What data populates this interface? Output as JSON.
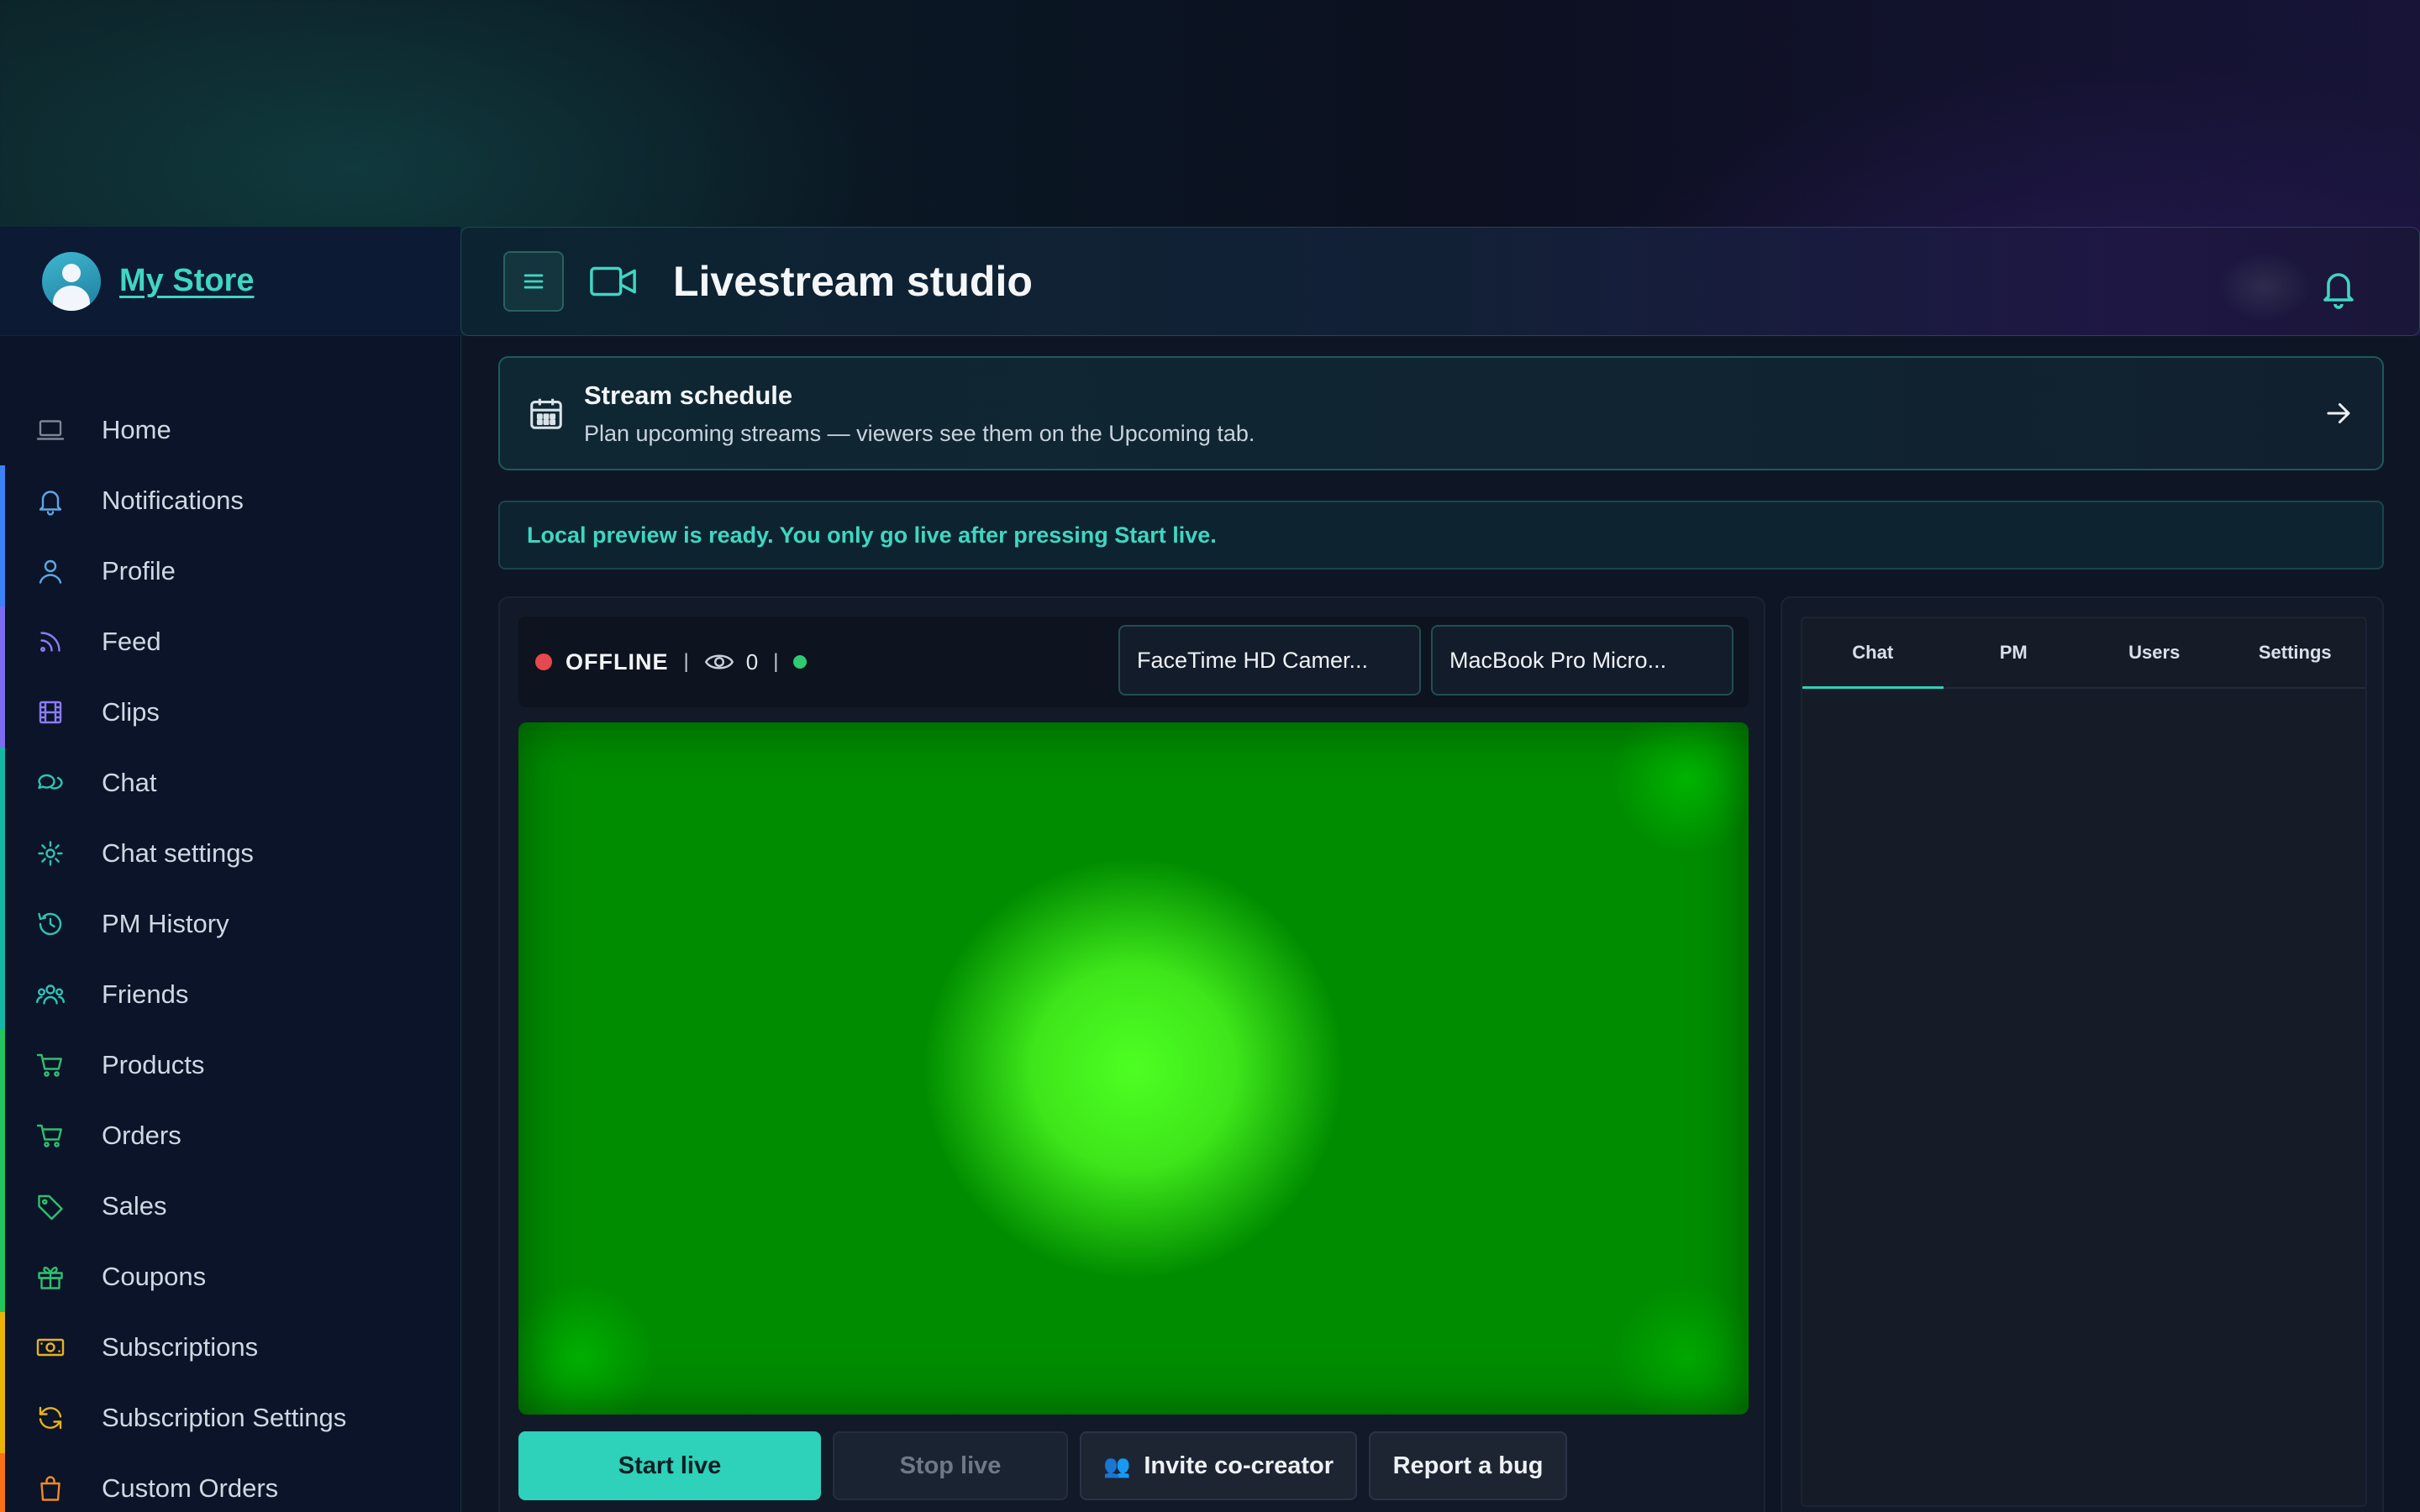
{
  "sidebar": {
    "brand": "My Store",
    "items": [
      {
        "label": "Home",
        "icon": "laptop-icon",
        "color": "#7b8795",
        "bar": "none"
      },
      {
        "label": "Notifications",
        "icon": "bell-icon",
        "color": "#5aa9e6",
        "bar": "#3b82f6"
      },
      {
        "label": "Profile",
        "icon": "user-icon",
        "color": "#5aa9e6",
        "bar": "#3b82f6"
      },
      {
        "label": "Feed",
        "icon": "rss-icon",
        "color": "#8b7cf6",
        "bar": "#7c6cf0"
      },
      {
        "label": "Clips",
        "icon": "film-icon",
        "color": "#8b7cf6",
        "bar": "#7c6cf0"
      },
      {
        "label": "Chat",
        "icon": "chat-bubbles-icon",
        "color": "#2ec4b6",
        "bar": "#14b8a6"
      },
      {
        "label": "Chat settings",
        "icon": "gear-icon",
        "color": "#2ec4b6",
        "bar": "#14b8a6"
      },
      {
        "label": "PM History",
        "icon": "history-icon",
        "color": "#2ec4b6",
        "bar": "#14b8a6"
      },
      {
        "label": "Friends",
        "icon": "users-icon",
        "color": "#2ec4b6",
        "bar": "#14b8a6"
      },
      {
        "label": "Products",
        "icon": "cart-icon",
        "color": "#2fbf71",
        "bar": "#22c55e"
      },
      {
        "label": "Orders",
        "icon": "cart-icon",
        "color": "#2fbf71",
        "bar": "#22c55e"
      },
      {
        "label": "Sales",
        "icon": "tag-icon",
        "color": "#2fbf71",
        "bar": "#22c55e"
      },
      {
        "label": "Coupons",
        "icon": "gift-icon",
        "color": "#2fbf71",
        "bar": "#22c55e"
      },
      {
        "label": "Subscriptions",
        "icon": "banknote-icon",
        "color": "#e8b21f",
        "bar": "#eab308"
      },
      {
        "label": "Subscription Settings",
        "icon": "refresh-icon",
        "color": "#e8b21f",
        "bar": "#eab308"
      },
      {
        "label": "Custom Orders",
        "icon": "bag-icon",
        "color": "#f08a24",
        "bar": "#f97316"
      }
    ]
  },
  "topbar": {
    "title": "Livestream studio"
  },
  "schedule": {
    "title": "Stream schedule",
    "subtitle": "Plan upcoming streams — viewers see them on the Upcoming tab."
  },
  "notice": "Local preview is ready. You only go live after pressing Start live.",
  "stage": {
    "status": "OFFLINE",
    "separator": "|",
    "viewers": "0",
    "camera": "FaceTime HD Camer...",
    "microphone": "MacBook Pro Micro...",
    "buttons": {
      "start": "Start live",
      "stop": "Stop live",
      "invite": "Invite co-creator",
      "invite_emoji": "👥",
      "bug": "Report a bug"
    }
  },
  "panel": {
    "tabs": [
      "Chat",
      "PM",
      "Users",
      "Settings"
    ],
    "active_tab": "Chat"
  },
  "colors": {
    "accent": "#2ed1b9",
    "offline_dot": "#e5484d",
    "online_dot": "#2ecc71"
  }
}
